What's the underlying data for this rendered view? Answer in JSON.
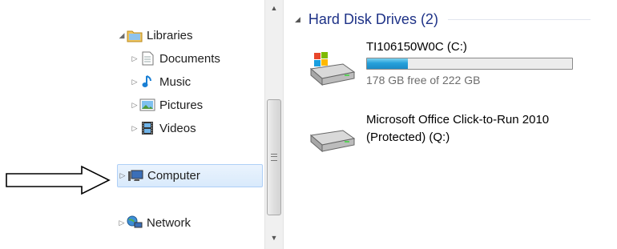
{
  "nav": {
    "items": [
      {
        "label": "Libraries",
        "icon": "libraries-icon",
        "expanded": true
      },
      {
        "label": "Documents",
        "icon": "documents-icon"
      },
      {
        "label": "Music",
        "icon": "music-icon"
      },
      {
        "label": "Pictures",
        "icon": "pictures-icon"
      },
      {
        "label": "Videos",
        "icon": "videos-icon"
      },
      {
        "label": "Computer",
        "icon": "computer-icon",
        "selected": true
      },
      {
        "label": "Network",
        "icon": "network-icon"
      }
    ]
  },
  "content": {
    "group_title": "Hard Disk Drives (2)",
    "drives": [
      {
        "name": "TI106150W0C (C:)",
        "free_text": "178 GB free of 222 GB",
        "used_fraction": 0.2
      },
      {
        "name_line1": "Microsoft Office Click-to-Run 2010",
        "name_line2": "(Protected) (Q:)"
      }
    ]
  },
  "colors": {
    "group_header": "#1e3287",
    "usage_bar": "#26a0da",
    "selection": "#d9eafc"
  }
}
